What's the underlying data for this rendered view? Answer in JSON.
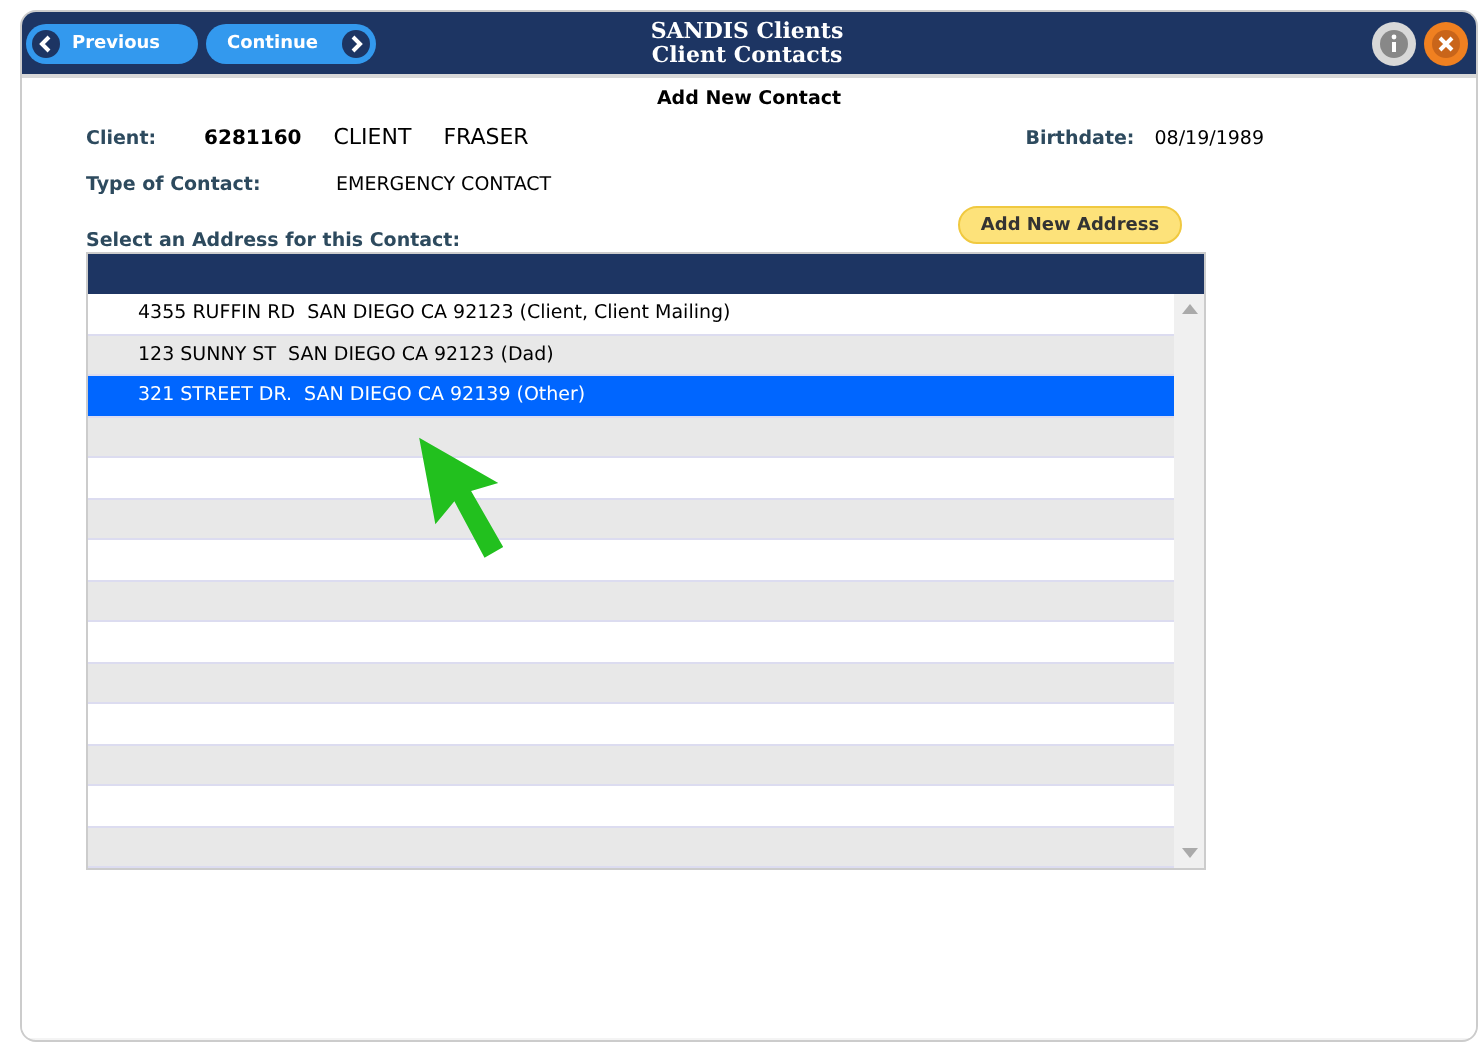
{
  "header": {
    "buttons": [
      {
        "label": "Previous",
        "kind": "back"
      },
      {
        "label": "Continue",
        "kind": "forward"
      }
    ],
    "title": "SANDIS Clients",
    "subtitle": "Client Contacts"
  },
  "form": {
    "title": "Add New Contact",
    "client_label": "Client:",
    "client_id": "6281160",
    "client_first": "CLIENT",
    "client_last": "FRASER",
    "birthdate_label": "Birthdate:",
    "birthdate": "08/19/1989",
    "contact_type_label": "Type of Contact:",
    "contact_type": "EMERGENCY CONTACT",
    "address_prompt": "Select an Address for this Contact:",
    "add_address_button": "Add New Address"
  },
  "addresses": [
    {
      "text": "4355 RUFFIN RD  SAN DIEGO CA 92123 (Client, Client Mailing)",
      "selected": false
    },
    {
      "text": "123 SUNNY ST  SAN DIEGO CA 92123 (Dad)",
      "selected": false
    },
    {
      "text": "321 STREET DR.  SAN DIEGO CA 92139 (Other)",
      "selected": true
    }
  ]
}
